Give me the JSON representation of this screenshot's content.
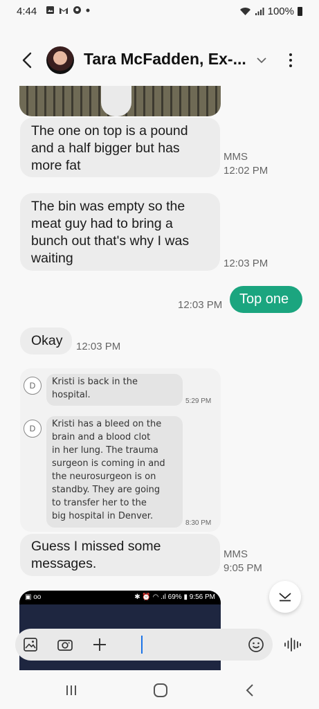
{
  "status_bar": {
    "time": "4:44",
    "battery": "100%",
    "notif_icons": [
      "image-icon",
      "gmail-icon",
      "app-icon",
      "dot-icon"
    ]
  },
  "header": {
    "contact_name": "Tara McFadden, Ex-..."
  },
  "messages": [
    {
      "text": " The one on top is a pound and a half bigger but has more fat",
      "type": "MMS",
      "time": "12:02 PM"
    },
    {
      "text": "The bin was empty so the meat guy had to bring a bunch out that's why I was waiting",
      "time": "12:03 PM"
    },
    {
      "text": "Top one",
      "time": "12:03 PM",
      "outgoing": true
    },
    {
      "text": "Okay",
      "time": "12:03 PM"
    },
    {
      "text": "Guess I missed some messages.",
      "type": "MMS",
      "time": "9:05 PM"
    }
  ],
  "embedded_screenshot": {
    "avatar_letter": "D",
    "messages": [
      {
        "text": "Kristi is back in the\nhospital.",
        "time": "5:29 PM"
      },
      {
        "text": "Kristi has a bleed on the\nbrain and a blood clot\nin her lung. The trauma\nsurgeon is coming in and\nthe neurosurgeon is on\nstandby. They are going\nto transfer her to the\nbig hospital in Denver.",
        "time": "8:30 PM"
      }
    ]
  },
  "bottom_image": {
    "status_left": "▣ oo",
    "status_right": "✱ ⏰ ◠ .ıl 69% ▮ 9:56 PM"
  },
  "colors": {
    "outgoing_bubble": "#1ba57f",
    "incoming_bubble": "#ececec",
    "cursor": "#1a73e8"
  }
}
